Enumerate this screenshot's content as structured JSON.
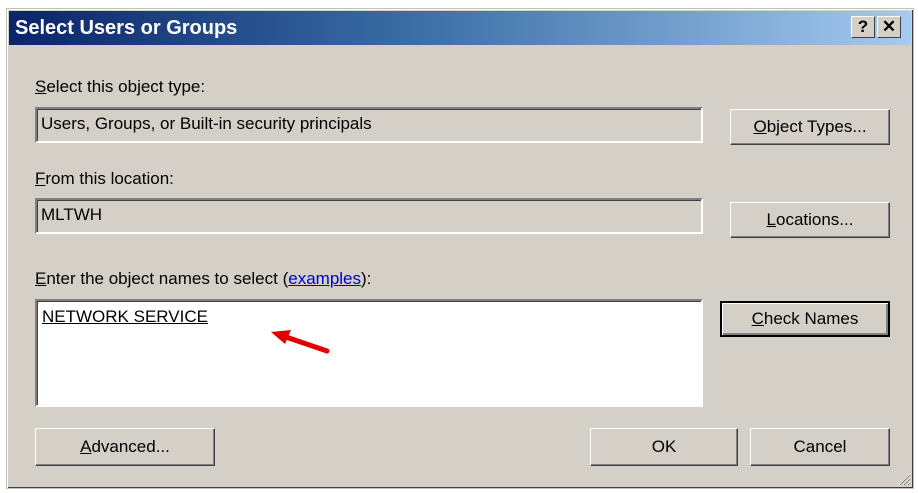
{
  "dialog": {
    "title": "Select Users or Groups",
    "help_label": "?",
    "close_label": "✕"
  },
  "object_type": {
    "label_prefix": "S",
    "label_rest": "elect this object type:",
    "value": "Users, Groups, or Built-in security principals",
    "button_prefix": "O",
    "button_rest": "bject Types..."
  },
  "location": {
    "label_prefix": "F",
    "label_rest": "rom this location:",
    "value": "MLTWH",
    "button_prefix": "L",
    "button_rest": "ocations..."
  },
  "names": {
    "label_prefix": "E",
    "label_rest": "nter the object names to select (",
    "link": "examples",
    "label_suffix": "):",
    "value": "NETWORK SERVICE",
    "check_prefix": "C",
    "check_rest": "heck Names"
  },
  "footer": {
    "advanced_prefix": "A",
    "advanced_rest": "dvanced...",
    "ok_label": "OK",
    "cancel_label": "Cancel"
  },
  "colors": {
    "annotation_arrow": "#e00000",
    "link": "#0000cc"
  },
  "icons": [
    "help-icon",
    "close-icon",
    "resize-grip-icon",
    "annotation-arrow-icon"
  ]
}
